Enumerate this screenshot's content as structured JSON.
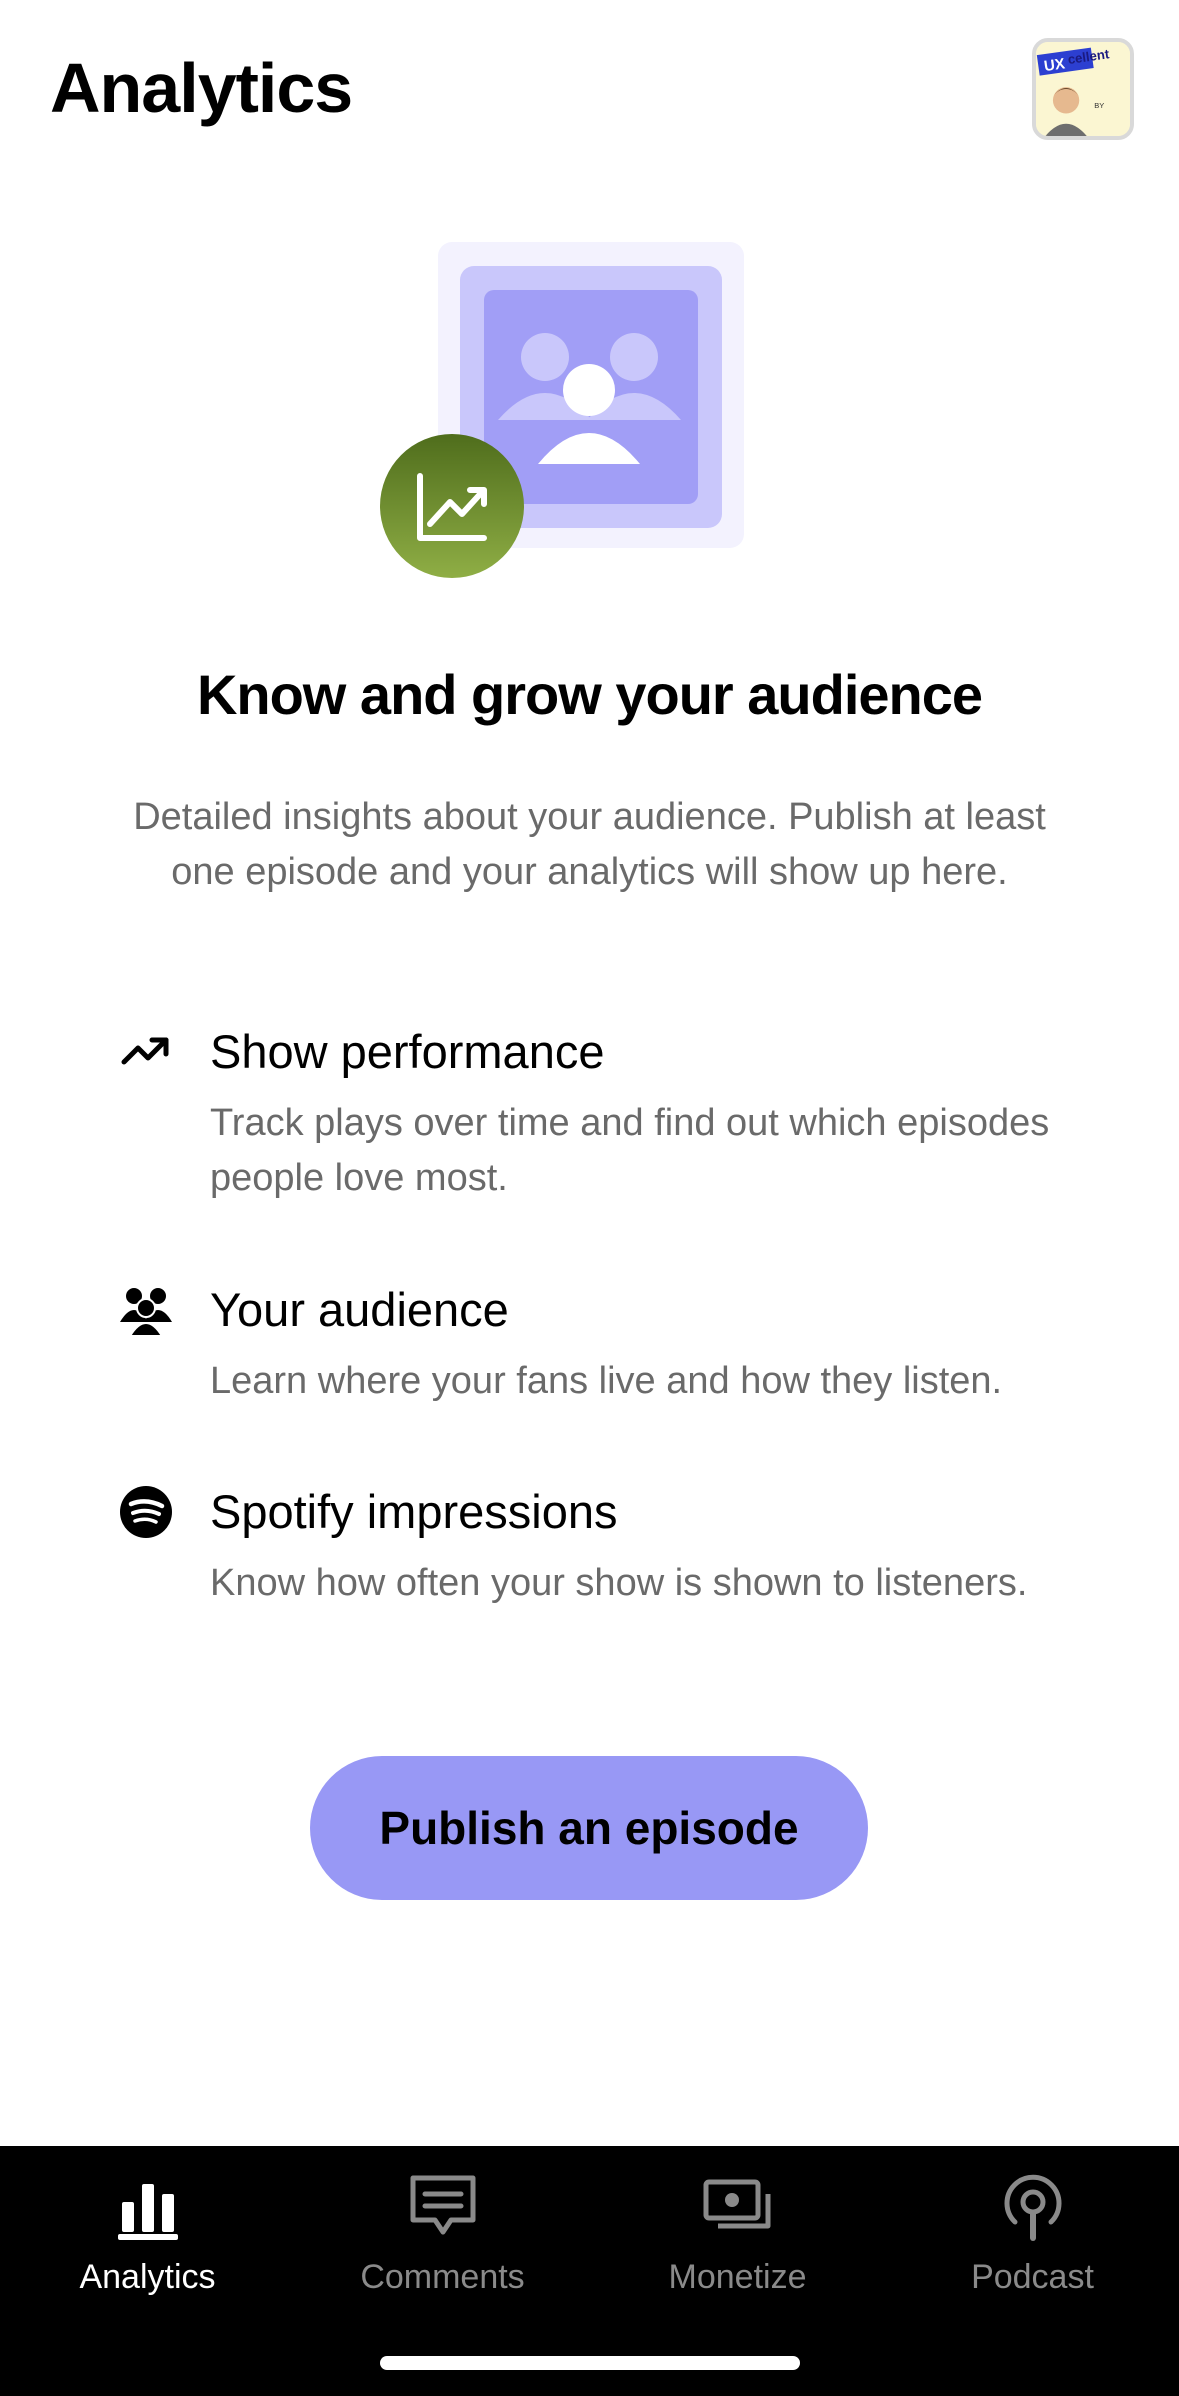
{
  "header": {
    "title": "Analytics",
    "avatar_text": "UXcellent",
    "avatar_subtext": "BY"
  },
  "hero": {
    "illustration": "audience-with-trend-icon",
    "colors": {
      "tile": "#a9a6f7",
      "tile_inner": "#8f8cf0",
      "badge": "#6c8a2a"
    }
  },
  "main": {
    "headline": "Know and grow your audience",
    "intro": "Detailed insights about your audience. Publish at least one episode and your analytics will show up here.",
    "features": [
      {
        "icon": "trend-up-icon",
        "title": "Show performance",
        "description": "Track plays over time and find out which episodes people love most."
      },
      {
        "icon": "audience-icon",
        "title": "Your audience",
        "description": "Learn where your fans live and how they listen."
      },
      {
        "icon": "spotify-icon",
        "title": "Spotify impressions",
        "description": "Know how often your show is shown to listeners."
      }
    ],
    "cta_label": "Publish an episode",
    "cta_color": "#9898f5"
  },
  "bottom_nav": {
    "items": [
      {
        "label": "Analytics",
        "icon": "bar-chart-icon",
        "active": true
      },
      {
        "label": "Comments",
        "icon": "comment-icon",
        "active": false
      },
      {
        "label": "Monetize",
        "icon": "money-icon",
        "active": false
      },
      {
        "label": "Podcast",
        "icon": "podcast-icon",
        "active": false
      }
    ]
  }
}
